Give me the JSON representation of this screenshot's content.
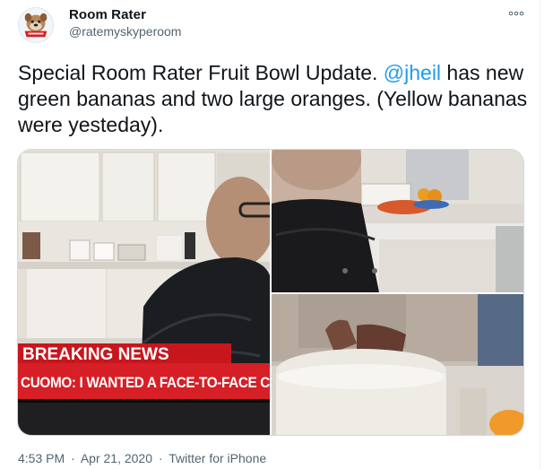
{
  "author": {
    "name": "Room Rater",
    "handle": "@ratemyskyperoom",
    "avatar_icon": "bulldog-mascot-icon"
  },
  "tweet": {
    "text_before": "Special Room Rater Fruit Bowl Update. ",
    "mention": "@jheil",
    "text_after": " has new green bananas and two large oranges.  (Yellow bananas were yesteday)."
  },
  "media": {
    "breaking_banner": "BREAKING NEWS",
    "headline": "CUOMO: I WANTED A FACE-TO-FACE C"
  },
  "footer": {
    "time": "4:53 PM",
    "date": "Apr 21, 2020",
    "separator": "·",
    "source": "Twitter for iPhone"
  },
  "colors": {
    "mention": "#1d9bf0",
    "breaking_red": "#d61f26",
    "muted": "#536471"
  }
}
